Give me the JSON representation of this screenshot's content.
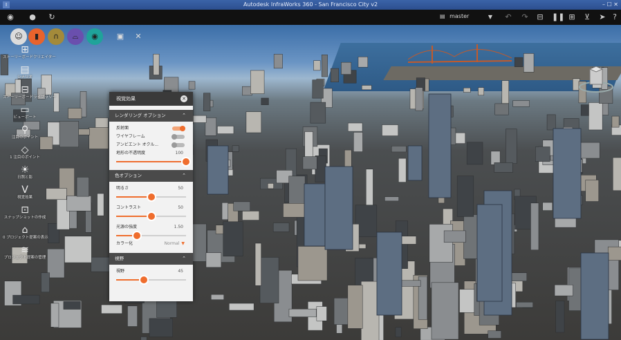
{
  "window": {
    "title": "Autodesk InfraWorks 360 - San Francisco City v2",
    "app_icon": "I",
    "controls": "– ☐ ✕"
  },
  "toolbar": {
    "left_icons": [
      "user-icon",
      "sync-icon",
      "refresh-icon"
    ],
    "branch_label": "master",
    "branch_icon": "▤",
    "right_icons": [
      "dropdown-icon",
      "undo-icon",
      "redo-icon",
      "panel-icon",
      "pause-icon",
      "grid-icon",
      "filter-icon",
      "pointer-icon",
      "help-icon"
    ]
  },
  "circle_tools": [
    {
      "name": "home-icon",
      "glyph": "☺",
      "color": "#dcdcdc"
    },
    {
      "name": "stack-icon",
      "glyph": "▮",
      "color": "#e8632c"
    },
    {
      "name": "road-icon",
      "glyph": "∩",
      "color": "#a38a3a"
    },
    {
      "name": "bridge-icon",
      "glyph": "⌓",
      "color": "#6a4fae"
    },
    {
      "name": "globe-icon",
      "glyph": "◉",
      "color": "#1fa39a"
    },
    {
      "name": "present-icon",
      "glyph": "▣",
      "color": "transparent"
    },
    {
      "name": "tools-icon",
      "glyph": "✕",
      "color": "transparent"
    }
  ],
  "left_tools": [
    {
      "label": "ストーリーボードクリエイター",
      "glyph": "⊞"
    },
    {
      "label": "シナリオ",
      "glyph": "▤"
    },
    {
      "label": "ストーリーボードライブラリー",
      "glyph": "⊟"
    },
    {
      "label": "ビューポート",
      "glyph": "▭"
    },
    {
      "label": "注目のポイント",
      "glyph": "⚲"
    },
    {
      "label": "1 注目のポイント",
      "glyph": "◇"
    },
    {
      "label": "日照と影",
      "glyph": "☀"
    },
    {
      "label": "視覚効果",
      "glyph": "V"
    },
    {
      "label": "スナップショットの作成",
      "glyph": "⊡"
    },
    {
      "label": "0 プロジェクト提案の表示",
      "glyph": "⌂"
    },
    {
      "label": "プロジェクト提案の管理",
      "glyph": "≋"
    }
  ],
  "panel": {
    "title": "視覚効果",
    "close": "✕",
    "rendering": {
      "header": "レンダリング オプション",
      "chevron": "⌃",
      "items": [
        {
          "label": "反射面",
          "on": true
        },
        {
          "label": "ワイヤフレーム",
          "on": false
        },
        {
          "label": "アンビエント オクル...",
          "on": false
        }
      ],
      "terrain_label": "地形の不透明度",
      "terrain_value": "100",
      "terrain_percent": 100
    },
    "color": {
      "header": "色オプション",
      "chevron": "⌃",
      "brightness_label": "明るさ",
      "brightness_value": "50",
      "brightness_percent": 50,
      "contrast_label": "コントラスト",
      "contrast_value": "50",
      "contrast_percent": 50,
      "saturation_label": "光源の強度",
      "saturation_value": "1.50",
      "saturation_percent": 30,
      "colorize_label": "カラー化",
      "colorize_value": "Normal",
      "colorize_arrow": "▼"
    },
    "view": {
      "header": "視野",
      "chevron": "⌃",
      "fov_label": "視野",
      "fov_value": "45",
      "fov_percent": 40
    }
  }
}
